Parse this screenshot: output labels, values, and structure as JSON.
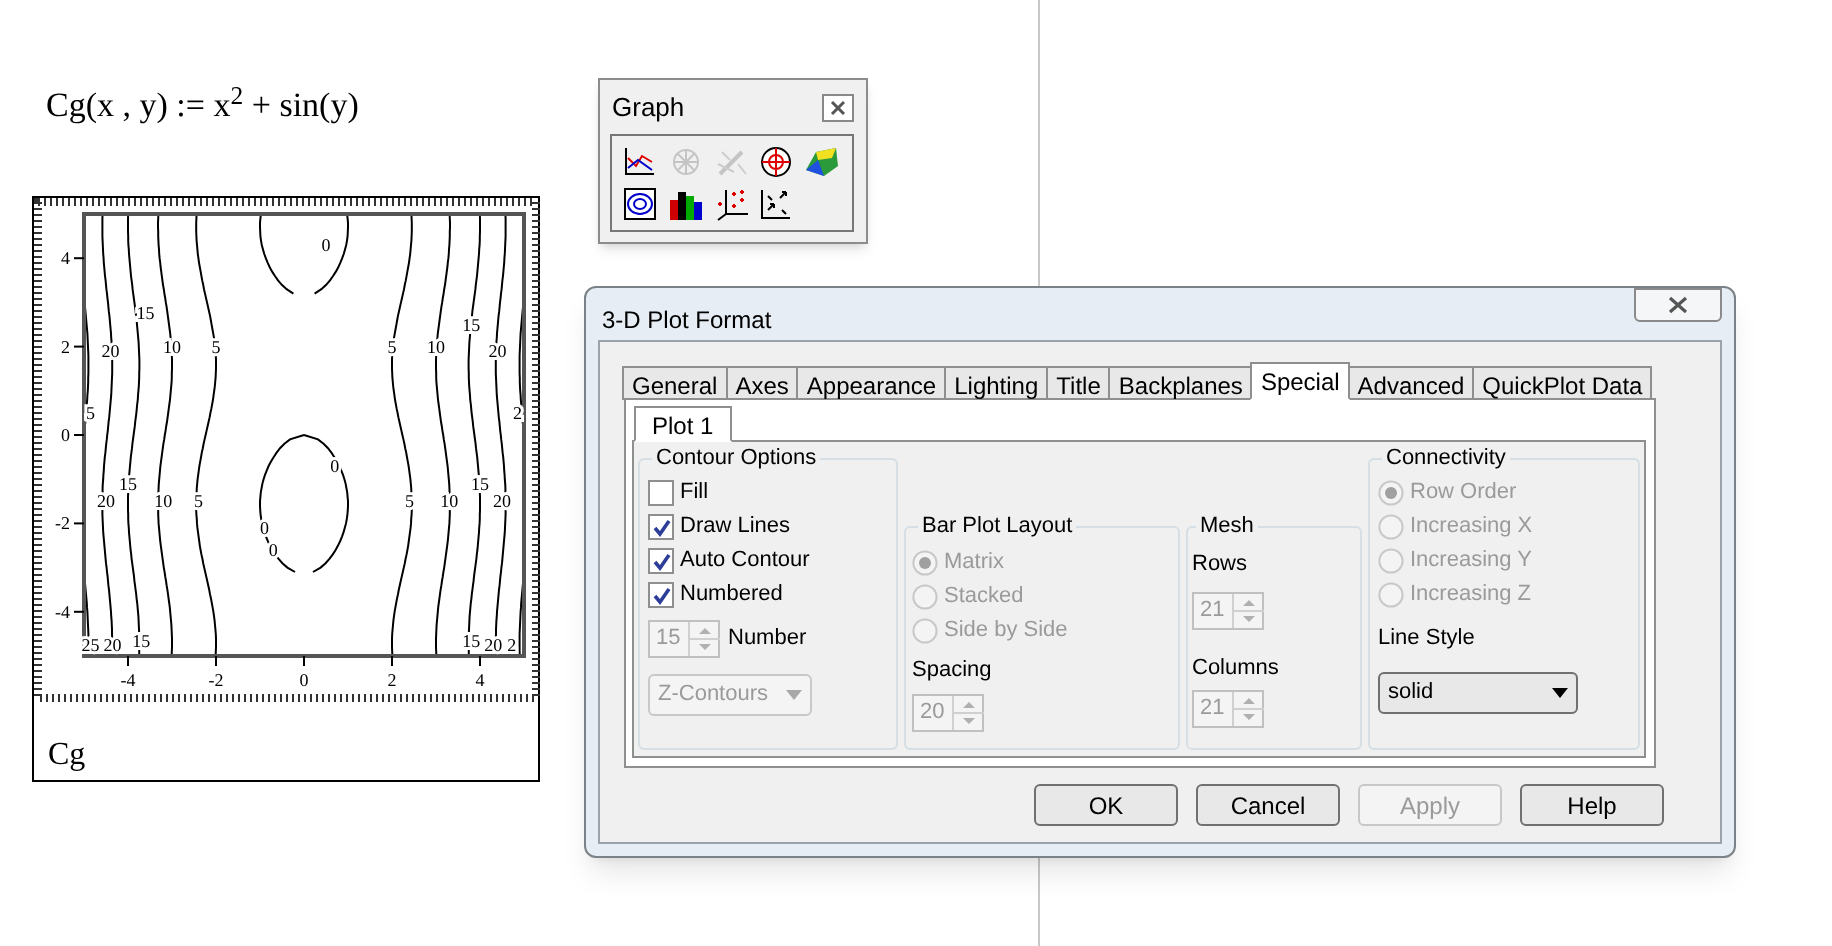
{
  "formula": "Cg(x , y) := x$^{2}$ + sin(y)",
  "plot": {
    "name": "Cg",
    "x_ticks": [
      "-4",
      "-2",
      "0",
      "2",
      "4"
    ],
    "y_ticks": [
      "4",
      "2",
      "0",
      "-2",
      "-4"
    ],
    "contour_labels": [
      "0",
      "15",
      "20",
      "10",
      "5",
      "5",
      "10",
      "15",
      "20",
      "5",
      "2",
      "0",
      "15",
      "20",
      "10",
      "5",
      "5",
      "10",
      "15",
      "20",
      "0",
      "0",
      "25",
      "20",
      "15",
      "15",
      "20",
      "2"
    ]
  },
  "graph_toolbar": {
    "title": "Graph",
    "tools": [
      {
        "kind": "line",
        "disabled": false
      },
      {
        "kind": "wheel",
        "disabled": true
      },
      {
        "kind": "wand",
        "disabled": true
      },
      {
        "kind": "target",
        "disabled": false
      },
      {
        "kind": "surface",
        "disabled": false
      },
      {
        "kind": "contour",
        "disabled": false
      },
      {
        "kind": "bars",
        "disabled": false
      },
      {
        "kind": "scatter",
        "disabled": false
      },
      {
        "kind": "vectors",
        "disabled": false
      }
    ]
  },
  "dialog": {
    "title": "3-D Plot Format",
    "tabs": [
      {
        "label": "General",
        "selected": false
      },
      {
        "label": "Axes",
        "selected": false
      },
      {
        "label": "Appearance",
        "selected": false
      },
      {
        "label": "Lighting",
        "selected": false
      },
      {
        "label": "Title",
        "selected": false
      },
      {
        "label": "Backplanes",
        "selected": false
      },
      {
        "label": "Special",
        "selected": true
      },
      {
        "label": "Advanced",
        "selected": false
      },
      {
        "label": "QuickPlot Data",
        "selected": false
      }
    ],
    "subtabs": [
      {
        "label": "Plot 1",
        "selected": true
      }
    ],
    "contour_options": {
      "title": "Contour Options",
      "checkboxes": [
        {
          "label": "Fill",
          "checked": false
        },
        {
          "label": "Draw Lines",
          "checked": true
        },
        {
          "label": "Auto Contour",
          "checked": true
        },
        {
          "label": "Numbered",
          "checked": true
        }
      ],
      "number": {
        "value": "15",
        "label": "Number",
        "disabled": true
      },
      "type": {
        "value": "Z-Contours",
        "disabled": true
      }
    },
    "bar_plot_layout": {
      "title": "Bar Plot Layout",
      "options": [
        {
          "label": "Matrix",
          "selected": true,
          "disabled": true
        },
        {
          "label": "Stacked",
          "selected": false,
          "disabled": true
        },
        {
          "label": "Side by Side",
          "selected": false,
          "disabled": true
        }
      ],
      "spacing": {
        "label": "Spacing",
        "value": "20",
        "disabled": true
      }
    },
    "mesh": {
      "title": "Mesh",
      "rows": {
        "label": "Rows",
        "value": "21",
        "disabled": true
      },
      "columns": {
        "label": "Columns",
        "value": "21",
        "disabled": true
      }
    },
    "connectivity": {
      "title": "Connectivity",
      "options": [
        {
          "label": "Row Order",
          "selected": true,
          "disabled": true
        },
        {
          "label": "Increasing X",
          "selected": false,
          "disabled": true
        },
        {
          "label": "Increasing Y",
          "selected": false,
          "disabled": true
        },
        {
          "label": "Increasing Z",
          "selected": false,
          "disabled": true
        }
      ],
      "line_style": {
        "label": "Line Style",
        "value": "solid",
        "disabled": false
      }
    },
    "buttons": [
      {
        "label": "OK",
        "disabled": false
      },
      {
        "label": "Cancel",
        "disabled": false
      },
      {
        "label": "Apply",
        "disabled": true
      },
      {
        "label": "Help",
        "disabled": false
      }
    ]
  }
}
